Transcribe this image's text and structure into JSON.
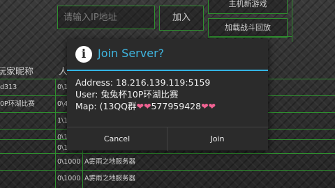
{
  "background": {
    "ip_placeholder": "请输入IP地址",
    "join_label": "加入",
    "host_new_game_label": "主机新游戏",
    "load_replay_label": "加载战斗回放",
    "columns": [
      "玩家昵称",
      "人"
    ],
    "rows": [
      {
        "name": "d313",
        "count": "0\\1"
      },
      {
        "name": "0P环湖比赛",
        "count": "0\\4"
      },
      {
        "name": "",
        "count": "1\\1"
      },
      {
        "name": "",
        "count": "0\\1"
      },
      {
        "name": "",
        "count": "0\\1"
      },
      {
        "name": "",
        "count": "0\\1000",
        "map": "A雾雨之地服务器"
      },
      {
        "name": "",
        "count": "0\\1000",
        "map": "A雾雨之地服务器"
      }
    ]
  },
  "dialog": {
    "title": "Join Server?",
    "address_line": "Address: 18.216.139.119:5159",
    "user_line": "User: 兔兔杯10P环湖比赛",
    "map_prefix": "Map: (13QQ群",
    "hearts_a": "❤❤",
    "map_number": "577959428",
    "hearts_b": "❤❤",
    "cancel_label": "Cancel",
    "join_label": "Join"
  },
  "colors": {
    "accent_blue": "#33b5e5",
    "frame_green": "#2f8f2f",
    "heart_pink": "#f06292"
  }
}
